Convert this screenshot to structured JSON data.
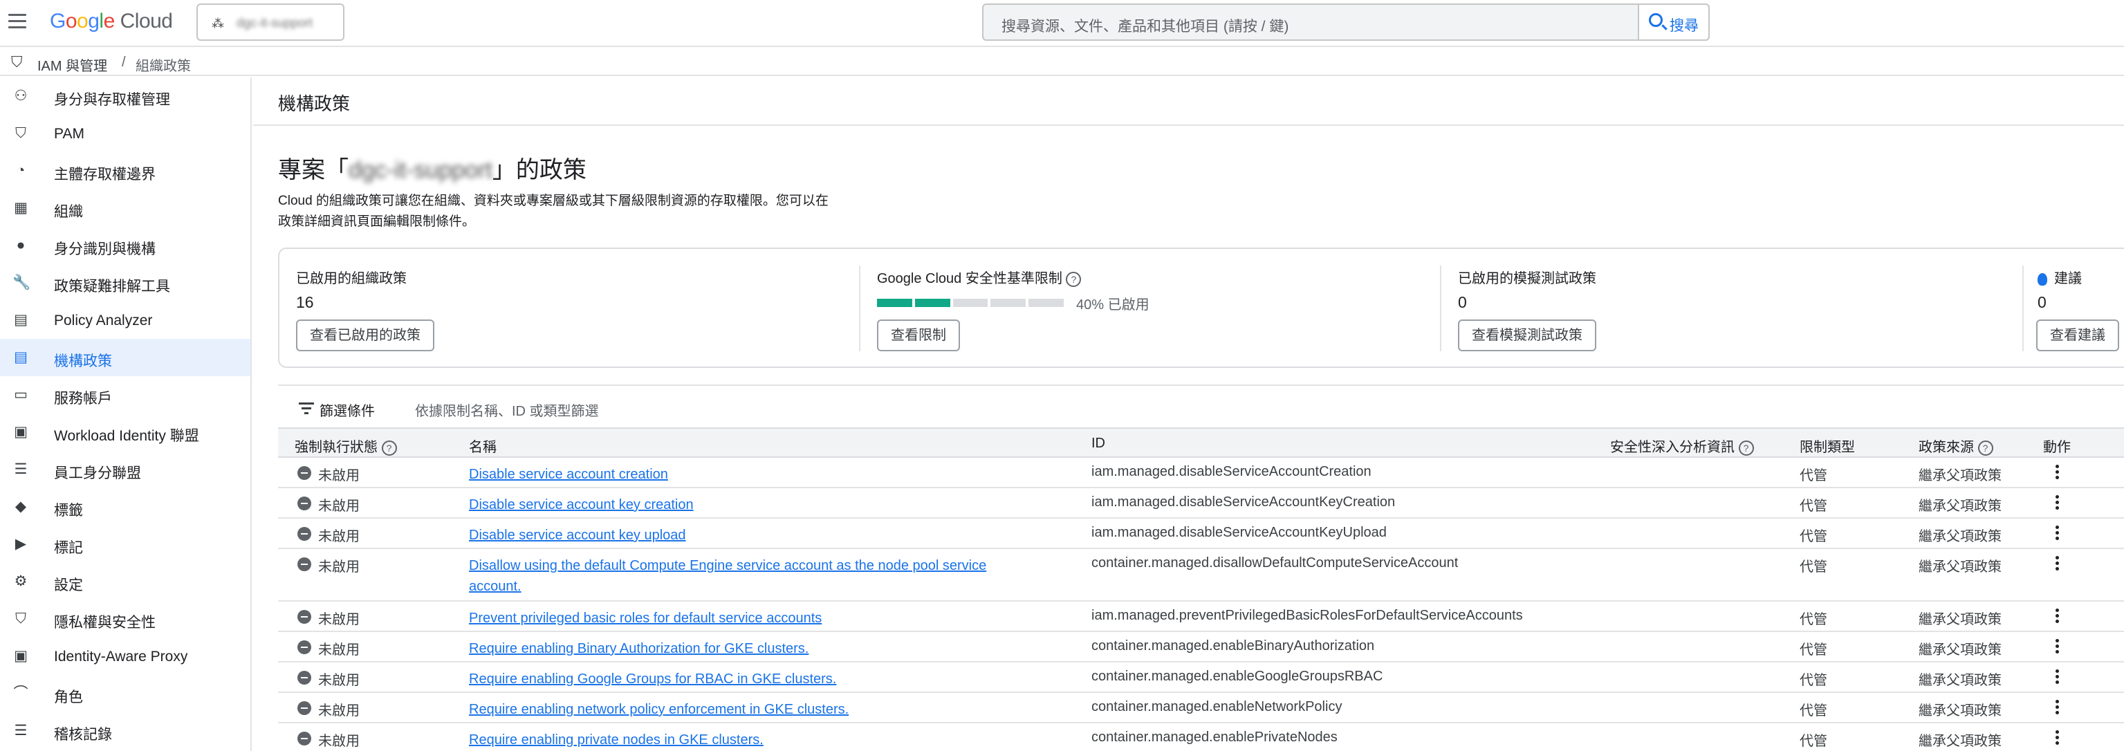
{
  "topbar": {
    "logo_google": "Google",
    "logo_cloud": "Cloud",
    "project_name": "dgc-it-support",
    "search_placeholder": "搜尋資源、文件、產品和其他項目 (請按 / 鍵)",
    "search_button": "搜尋"
  },
  "breadcrumb": {
    "section": "IAM 與管理",
    "separator": "/",
    "current": "組織政策"
  },
  "sidebar": {
    "items": [
      {
        "label": "身分與存取權管理",
        "icon": "person-add-icon"
      },
      {
        "label": "PAM",
        "icon": "shield-clock-icon"
      },
      {
        "label": "主體存取權邊界",
        "icon": "boundary-icon"
      },
      {
        "label": "組織",
        "icon": "organization-icon"
      },
      {
        "label": "身分識別與機構",
        "icon": "account-circle-icon"
      },
      {
        "label": "政策疑難排解工具",
        "icon": "wrench-icon"
      },
      {
        "label": "Policy Analyzer",
        "icon": "policy-analyzer-icon"
      },
      {
        "label": "機構政策",
        "icon": "policy-doc-icon"
      },
      {
        "label": "服務帳戶",
        "icon": "service-account-icon"
      },
      {
        "label": "Workload Identity 聯盟",
        "icon": "workload-identity-icon"
      },
      {
        "label": "員工身分聯盟",
        "icon": "list-icon"
      },
      {
        "label": "標籤",
        "icon": "tag-icon"
      },
      {
        "label": "標記",
        "icon": "label-icon"
      },
      {
        "label": "設定",
        "icon": "gear-icon"
      },
      {
        "label": "隱私權與安全性",
        "icon": "privacy-shield-icon"
      },
      {
        "label": "Identity-Aware Proxy",
        "icon": "proxy-icon"
      },
      {
        "label": "角色",
        "icon": "hat-icon"
      },
      {
        "label": "稽核記錄",
        "icon": "audit-log-icon"
      }
    ],
    "active_index": 7
  },
  "main": {
    "page_title": "機構政策",
    "project_heading_prefix": "專案「",
    "project_heading_name": "dgc-it-support",
    "project_heading_suffix": "」的政策",
    "description": "Cloud 的組織政策可讓您在組織、資料夾或專案層級或其下層級限制資源的存取權限。您可以在政策詳細資訊頁面編輯限制條件。",
    "cards": [
      {
        "label": "已啟用的組織政策",
        "value": "16",
        "button": "查看已啟用的政策"
      },
      {
        "label": "Google Cloud 安全性基準限制",
        "progress_percent": 40,
        "progress_text": "40% 已啟用",
        "button": "查看限制"
      },
      {
        "label": "已啟用的模擬測試政策",
        "value": "0",
        "button": "查看模擬測試政策"
      },
      {
        "label": "建議",
        "value": "0",
        "button": "查看建議"
      }
    ],
    "filter": {
      "label": "篩選條件",
      "placeholder": "依據限制名稱、ID 或類型篩選"
    },
    "table": {
      "headers": {
        "status": "強制執行狀態",
        "name": "名稱",
        "id": "ID",
        "insights": "安全性深入分析資訊",
        "type": "限制類型",
        "source": "政策來源",
        "actions": "動作"
      },
      "rows": [
        {
          "status": "未啟用",
          "name": "Disable service account creation",
          "id": "iam.managed.disableServiceAccountCreation",
          "type": "代管",
          "source": "繼承父項政策"
        },
        {
          "status": "未啟用",
          "name": "Disable service account key creation",
          "id": "iam.managed.disableServiceAccountKeyCreation",
          "type": "代管",
          "source": "繼承父項政策"
        },
        {
          "status": "未啟用",
          "name": "Disable service account key upload",
          "id": "iam.managed.disableServiceAccountKeyUpload",
          "type": "代管",
          "source": "繼承父項政策"
        },
        {
          "status": "未啟用",
          "name": "Disallow using the default Compute Engine service account as the node pool service account.",
          "id": "container.managed.disallowDefaultComputeServiceAccount",
          "type": "代管",
          "source": "繼承父項政策"
        },
        {
          "status": "未啟用",
          "name": "Prevent privileged basic roles for default service accounts",
          "id": "iam.managed.preventPrivilegedBasicRolesForDefaultServiceAccounts",
          "type": "代管",
          "source": "繼承父項政策"
        },
        {
          "status": "未啟用",
          "name": "Require enabling Binary Authorization for GKE clusters.",
          "id": "container.managed.enableBinaryAuthorization",
          "type": "代管",
          "source": "繼承父項政策"
        },
        {
          "status": "未啟用",
          "name": "Require enabling Google Groups for RBAC in GKE clusters.",
          "id": "container.managed.enableGoogleGroupsRBAC",
          "type": "代管",
          "source": "繼承父項政策"
        },
        {
          "status": "未啟用",
          "name": "Require enabling network policy enforcement in GKE clusters.",
          "id": "container.managed.enableNetworkPolicy",
          "type": "代管",
          "source": "繼承父項政策"
        },
        {
          "status": "未啟用",
          "name": "Require enabling private nodes in GKE clusters.",
          "id": "container.managed.enablePrivateNodes",
          "type": "代管",
          "source": "繼承父項政策"
        }
      ]
    }
  },
  "colors": {
    "accent": "#1a73e8",
    "progress_fill": "#12a887",
    "active_nav_bg": "#e8f0fe"
  }
}
